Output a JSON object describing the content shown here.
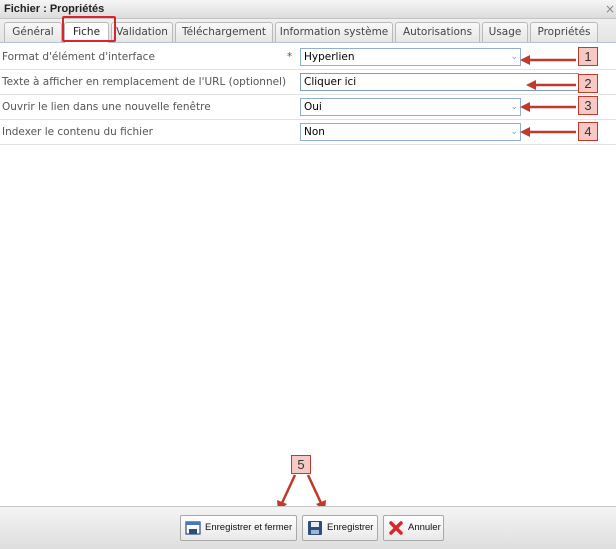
{
  "window": {
    "title": "Fichier : Propriétés",
    "close_glyph": "×"
  },
  "tabs": [
    {
      "label": "Général"
    },
    {
      "label": "Fiche",
      "active": true
    },
    {
      "label": "Validation"
    },
    {
      "label": "Téléchargement"
    },
    {
      "label": "Information système"
    },
    {
      "label": "Autorisations"
    },
    {
      "label": "Usage"
    },
    {
      "label": "Propriétés"
    }
  ],
  "form": {
    "rows": [
      {
        "label": "Format d'élément d'interface",
        "required_mark": "*",
        "value": "Hyperlien",
        "type": "select"
      },
      {
        "label": "Texte à afficher en remplacement de l'URL (optionnel)",
        "value": "Cliquer ici",
        "type": "text"
      },
      {
        "label": "Ouvrir le lien dans une nouvelle fenêtre",
        "value": "Oui",
        "type": "select"
      },
      {
        "label": "Indexer le contenu du fichier",
        "value": "Non",
        "type": "select"
      }
    ]
  },
  "annotations": {
    "labels": [
      "1",
      "2",
      "3",
      "4",
      "5"
    ],
    "color": "#c0392b"
  },
  "footer": {
    "buttons": [
      {
        "label": "Enregistrer et fermer",
        "icon": "save-close-icon"
      },
      {
        "label": "Enregistrer",
        "icon": "floppy-disk-icon"
      },
      {
        "label": "Annuler",
        "icon": "cancel-x-icon"
      }
    ]
  }
}
